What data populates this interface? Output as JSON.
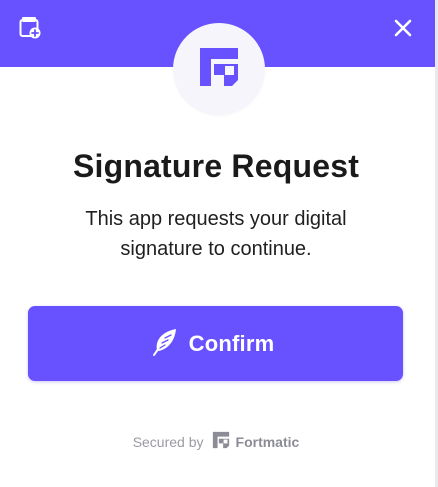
{
  "header": {
    "color": "#6851ff",
    "left_icon": "wallet-add-icon",
    "close_icon": "close-icon"
  },
  "logo": {
    "icon": "fortmatic-logo-icon",
    "color": "#6851ff"
  },
  "title": "Signature Request",
  "subtitle": "This app requests your digital signature to continue.",
  "confirm": {
    "label": "Confirm",
    "icon": "feather-icon",
    "color": "#6851ff"
  },
  "footer": {
    "secured_by": "Secured by",
    "brand": "Fortmatic",
    "brand_icon": "fortmatic-logo-icon"
  }
}
